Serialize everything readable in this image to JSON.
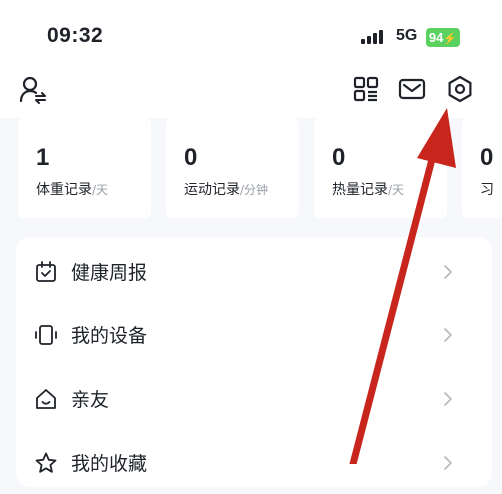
{
  "status_bar": {
    "time": "09:32",
    "network": "5G",
    "battery": "94"
  },
  "header": {
    "icons": [
      "user-switch-icon",
      "qr-grid-icon",
      "mail-icon",
      "settings-hex-icon"
    ]
  },
  "stats": [
    {
      "value": "1",
      "label": "体重记录",
      "unit": "/天"
    },
    {
      "value": "0",
      "label": "运动记录",
      "unit": "/分钟"
    },
    {
      "value": "0",
      "label": "热量记录",
      "unit": "/天"
    },
    {
      "value": "0",
      "label": "习",
      "unit": ""
    }
  ],
  "menu": [
    {
      "label": "健康周报",
      "icon": "calendar-check-icon"
    },
    {
      "label": "我的设备",
      "icon": "device-icon"
    },
    {
      "label": "亲友",
      "icon": "home-smile-icon"
    },
    {
      "label": "我的收藏",
      "icon": "star-icon"
    }
  ],
  "colors": {
    "battery": "#5bd15f",
    "annotation_arrow": "#c8251d",
    "background": "#f6f8fb"
  }
}
